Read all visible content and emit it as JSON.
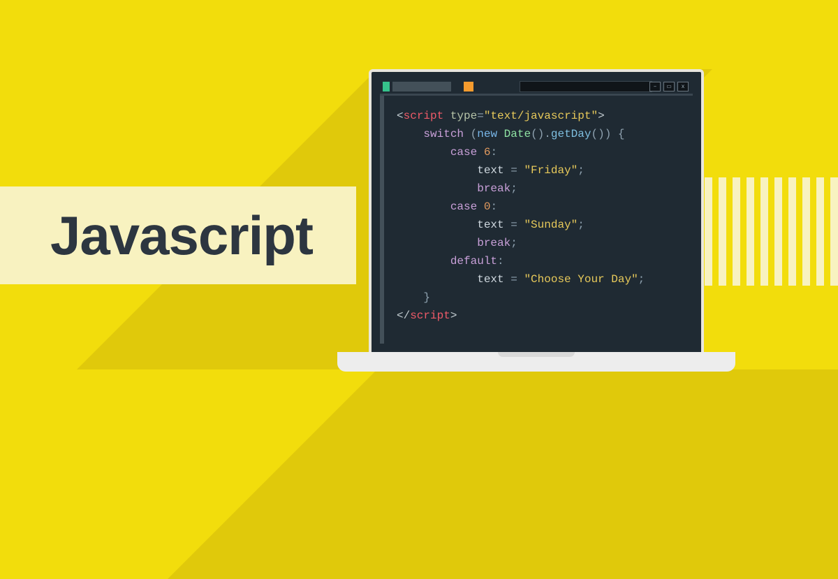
{
  "title": "Javascript",
  "window_buttons": [
    "–",
    "▭",
    "x"
  ],
  "code_lines": [
    {
      "indent": 0,
      "segments": [
        [
          "ang",
          "<"
        ],
        [
          "tag",
          "script"
        ],
        [
          "id",
          " "
        ],
        [
          "attr",
          "type"
        ],
        [
          "punc",
          "="
        ],
        [
          "str",
          "\"text/javascript\""
        ],
        [
          "ang",
          ">"
        ]
      ]
    },
    {
      "indent": 1,
      "segments": [
        [
          "kw",
          "switch"
        ],
        [
          "id",
          " "
        ],
        [
          "punc",
          "("
        ],
        [
          "kw2",
          "new"
        ],
        [
          "id",
          " "
        ],
        [
          "cls",
          "Date"
        ],
        [
          "punc",
          "()."
        ],
        [
          "mth",
          "getDay"
        ],
        [
          "punc",
          "()) {"
        ]
      ]
    },
    {
      "indent": 2,
      "segments": [
        [
          "kw",
          "case"
        ],
        [
          "id",
          " "
        ],
        [
          "num",
          "6"
        ],
        [
          "punc",
          ":"
        ]
      ]
    },
    {
      "indent": 3,
      "segments": [
        [
          "id",
          "text "
        ],
        [
          "punc",
          "= "
        ],
        [
          "str",
          "\"Friday\""
        ],
        [
          "punc",
          ";"
        ]
      ]
    },
    {
      "indent": 3,
      "segments": [
        [
          "brk",
          "break"
        ],
        [
          "punc",
          ";"
        ]
      ]
    },
    {
      "indent": 2,
      "segments": [
        [
          "kw",
          "case"
        ],
        [
          "id",
          " "
        ],
        [
          "num",
          "0"
        ],
        [
          "punc",
          ":"
        ]
      ]
    },
    {
      "indent": 3,
      "segments": [
        [
          "id",
          "text "
        ],
        [
          "punc",
          "= "
        ],
        [
          "str",
          "\"Sunday\""
        ],
        [
          "punc",
          ";"
        ]
      ]
    },
    {
      "indent": 3,
      "segments": [
        [
          "brk",
          "break"
        ],
        [
          "punc",
          ";"
        ]
      ]
    },
    {
      "indent": 2,
      "segments": [
        [
          "kw",
          "default"
        ],
        [
          "punc",
          ":"
        ]
      ]
    },
    {
      "indent": 3,
      "segments": [
        [
          "id",
          "text "
        ],
        [
          "punc",
          "= "
        ],
        [
          "str",
          "\"Choose Your Day\""
        ],
        [
          "punc",
          ";"
        ]
      ]
    },
    {
      "indent": 1,
      "segments": [
        [
          "punc",
          "}"
        ]
      ]
    },
    {
      "indent": 0,
      "segments": [
        [
          "ang",
          "</"
        ],
        [
          "tag",
          "script"
        ],
        [
          "ang",
          ">"
        ]
      ]
    }
  ],
  "stripe_count": 11
}
